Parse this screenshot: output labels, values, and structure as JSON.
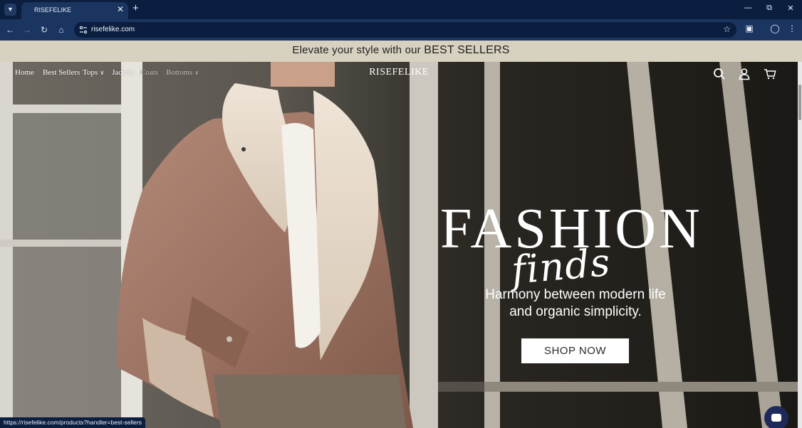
{
  "browser": {
    "tab_title": "RISEFELIKE",
    "url": "risefelike.com",
    "status_url": "https://risefelike.com/products?handler=best-sellers"
  },
  "announcement": {
    "prefix": "Elevate your style with our ",
    "highlight": "BEST SELLERS"
  },
  "header": {
    "brand": "RISEFELIKE",
    "nav": {
      "home": "Home",
      "best_sellers": "Best Sellers",
      "tops": "Tops",
      "jackets": "Jackets",
      "coats": "Coats",
      "bottoms": "Bottoms"
    }
  },
  "hero": {
    "headline": "FASHION",
    "script": "finds",
    "tagline_line1": "Harmony between modern life",
    "tagline_line2": "and organic simplicity.",
    "cta": "SHOP NOW"
  },
  "colors": {
    "chrome_dark": "#0b1e3f",
    "chrome_toolbar": "#1a3560",
    "announcement_bg": "#d7d1bf",
    "chat_button": "#1e2a5a"
  }
}
